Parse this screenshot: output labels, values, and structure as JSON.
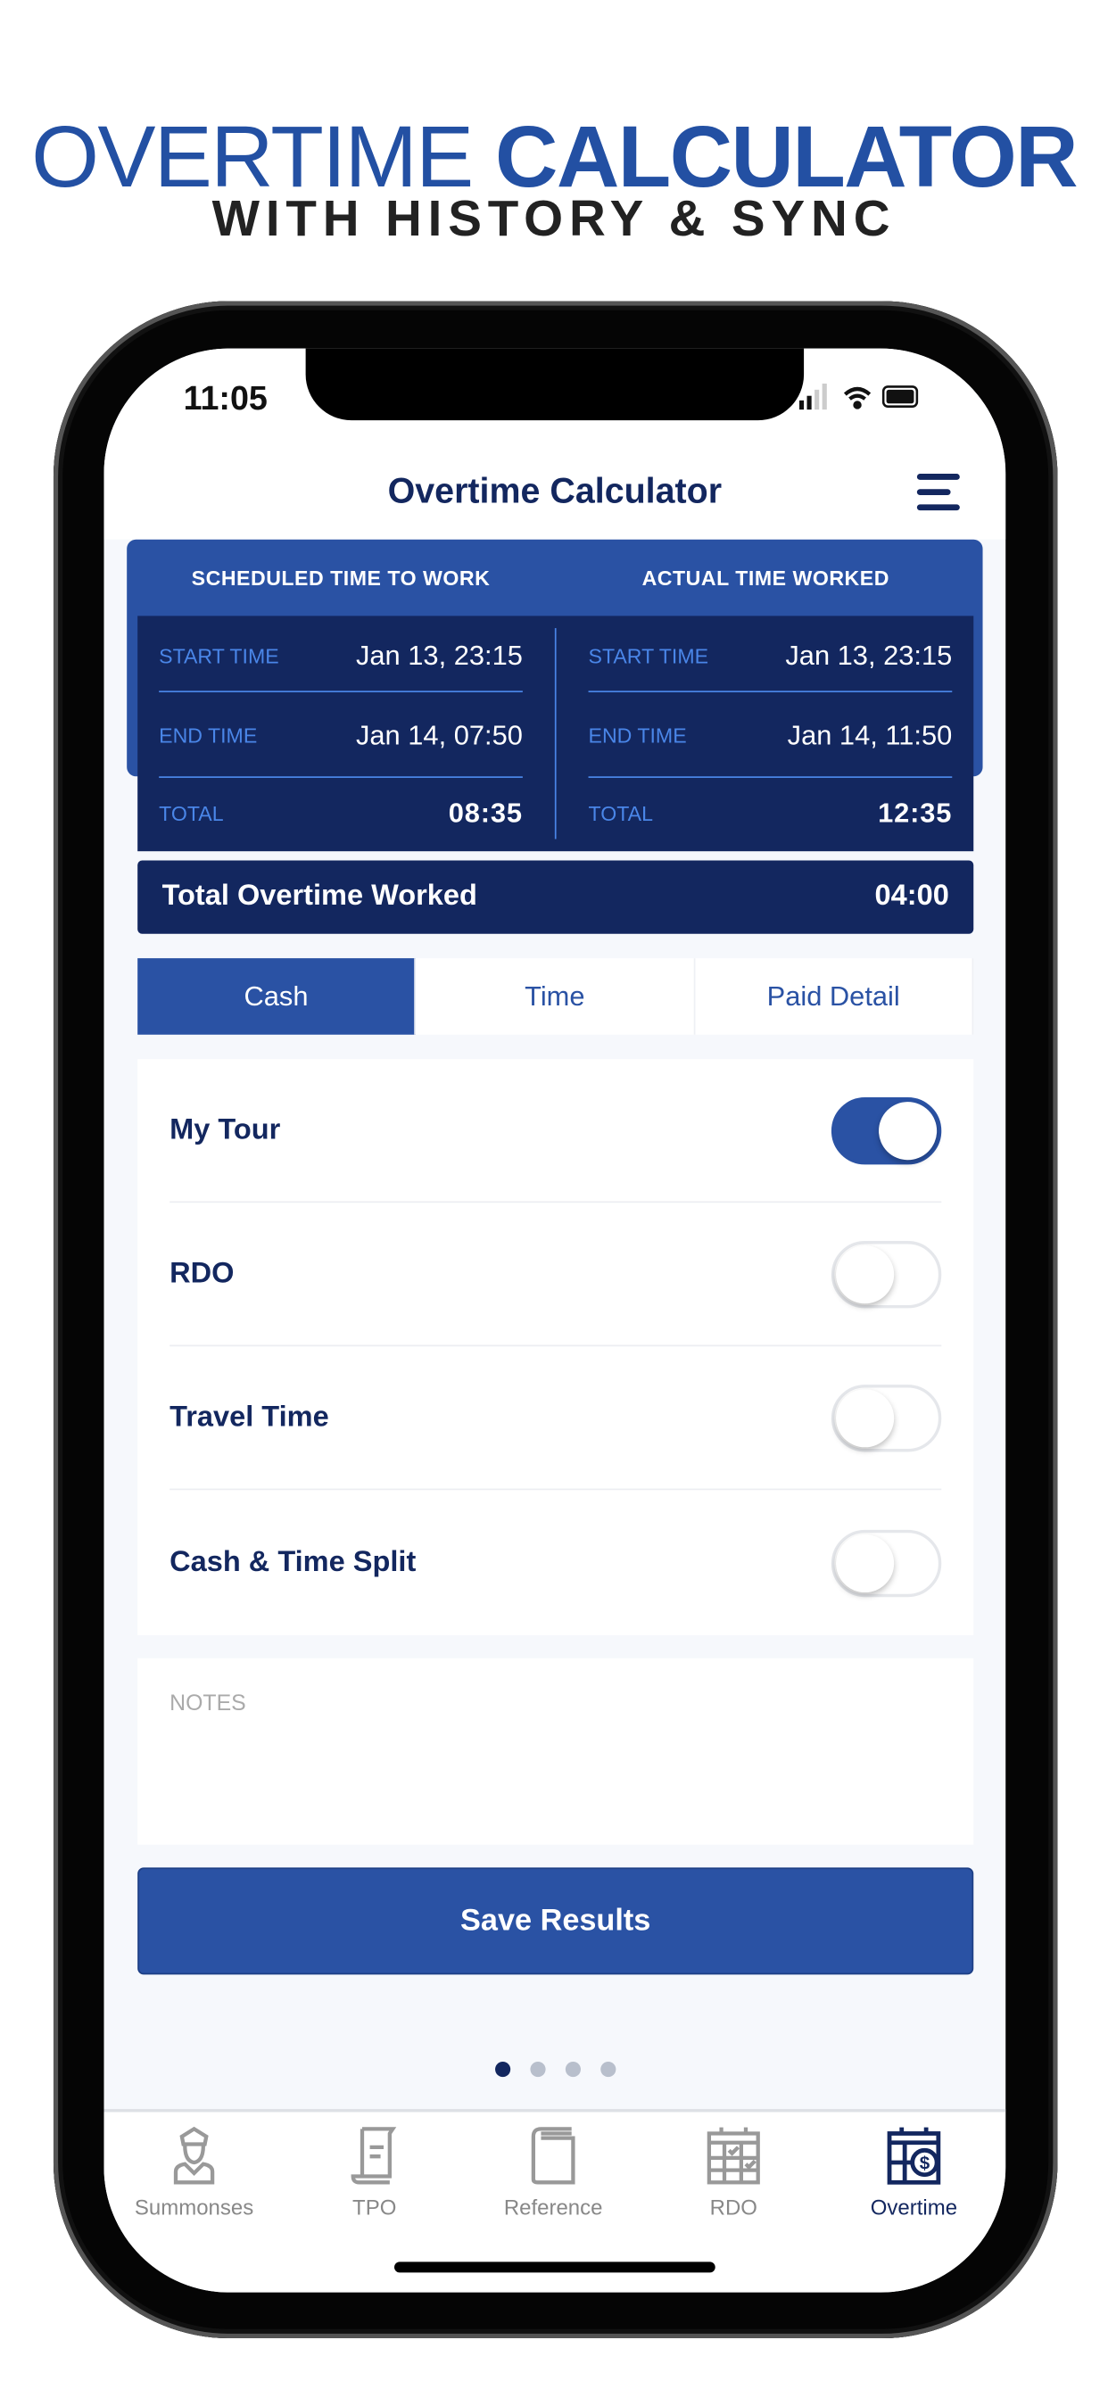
{
  "promo": {
    "title_light": "OVERTIME",
    "title_bold": "CALCULATOR",
    "subtitle": "WITH HISTORY & SYNC"
  },
  "status_bar": {
    "time": "11:05",
    "icons": [
      "signal-icon",
      "wifi-icon",
      "battery-icon"
    ]
  },
  "header": {
    "title": "Overtime Calculator",
    "menu_icon": "hamburger-menu-icon"
  },
  "scheduled": {
    "heading": "SCHEDULED TIME TO WORK",
    "start_label": "START TIME",
    "start": "Jan 13, 23:15",
    "end_label": "END TIME",
    "end": "Jan 14, 07:50",
    "total_label": "TOTAL",
    "total": "08:35"
  },
  "actual": {
    "heading": "ACTUAL TIME WORKED",
    "start_label": "START TIME",
    "start": "Jan 13, 23:15",
    "end_label": "END TIME",
    "end": "Jan 14, 11:50",
    "total_label": "TOTAL",
    "total": "12:35"
  },
  "overtime": {
    "label": "Total Overtime Worked",
    "value": "04:00"
  },
  "tabs": [
    {
      "label": "Cash",
      "active": true
    },
    {
      "label": "Time",
      "active": false
    },
    {
      "label": "Paid Detail",
      "active": false
    }
  ],
  "toggles": [
    {
      "label": "My Tour",
      "on": true
    },
    {
      "label": "RDO",
      "on": false
    },
    {
      "label": "Travel Time",
      "on": false
    },
    {
      "label": "Cash & Time Split",
      "on": false
    }
  ],
  "notes": {
    "placeholder": "NOTES"
  },
  "save_label": "Save Results",
  "pager": {
    "pages": 4,
    "current": 1
  },
  "tabbar": [
    {
      "label": "Summonses",
      "icon": "officer-icon"
    },
    {
      "label": "TPO",
      "icon": "scroll-icon"
    },
    {
      "label": "Reference",
      "icon": "book-icon"
    },
    {
      "label": "RDO",
      "icon": "calendar-check-icon"
    },
    {
      "label": "Overtime",
      "icon": "calendar-dollar-icon",
      "active": true
    }
  ],
  "colors": {
    "primary": "#2a52a4",
    "dark": "#13275f",
    "accent": "#4a86e8"
  }
}
